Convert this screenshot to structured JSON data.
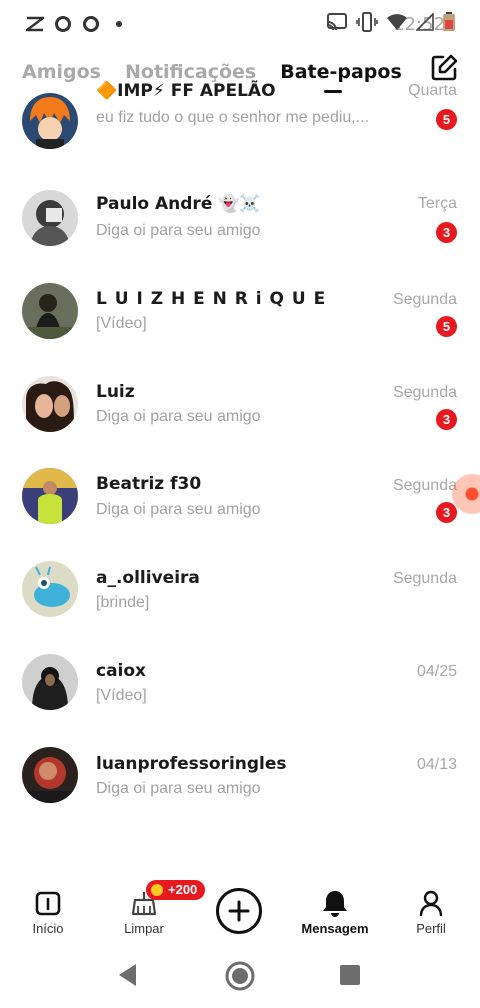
{
  "status_bar": {
    "time": "12:52",
    "left_icons": [
      "zigzag-icon",
      "circle-o-icon",
      "circle-o-icon",
      "dot-icon"
    ],
    "right_icons": [
      "cast-icon",
      "vibrate-icon",
      "wifi-icon",
      "signal-icon",
      "battery-icon"
    ]
  },
  "tabs": [
    {
      "label": "Amigos",
      "active": false
    },
    {
      "label": "Notificações",
      "active": false
    },
    {
      "label": "Bate-papos",
      "active": true
    }
  ],
  "compose_icon": "compose-icon",
  "chats": [
    {
      "name": "🔶IMP⚡ FF APELÃO",
      "preview": "eu fiz tudo o que o senhor me pediu,...",
      "time": "Quarta",
      "unread": "5"
    },
    {
      "name": "Paulo André 👻☠️",
      "preview": "Diga oi para seu amigo",
      "time": "Terça",
      "unread": "3"
    },
    {
      "name": "L U I Z   H E N R i Q U E",
      "preview": "[Vídeo]",
      "time": "Segunda",
      "unread": "5"
    },
    {
      "name": "Luiz",
      "preview": "Diga oi para seu amigo",
      "time": "Segunda",
      "unread": "3"
    },
    {
      "name": "Beatriz   f30",
      "preview": "Diga oi para seu amigo",
      "time": "Segunda",
      "unread": "3"
    },
    {
      "name": "a_.olliveira",
      "preview": "[brinde]",
      "time": "Segunda",
      "unread": ""
    },
    {
      "name": "caiox",
      "preview": "[Vídeo]",
      "time": "04/25",
      "unread": ""
    },
    {
      "name": "luanprofessoringles",
      "preview": "Diga oi para seu amigo",
      "time": "04/13",
      "unread": ""
    }
  ],
  "bottom_nav": {
    "items": [
      {
        "label": "Início",
        "icon": "home-icon"
      },
      {
        "label": "Limpar",
        "icon": "broom-icon"
      },
      {
        "label": "",
        "icon": "plus-icon"
      },
      {
        "label": "Mensagem",
        "icon": "bell-icon"
      },
      {
        "label": "Perfil",
        "icon": "person-icon"
      }
    ],
    "promo_badge": "+200"
  },
  "colors": {
    "accent_red": "#e8181f",
    "text_primary": "#1b1b1b",
    "text_secondary": "#a2a2a2",
    "tab_inactive": "#a9a9a9"
  }
}
